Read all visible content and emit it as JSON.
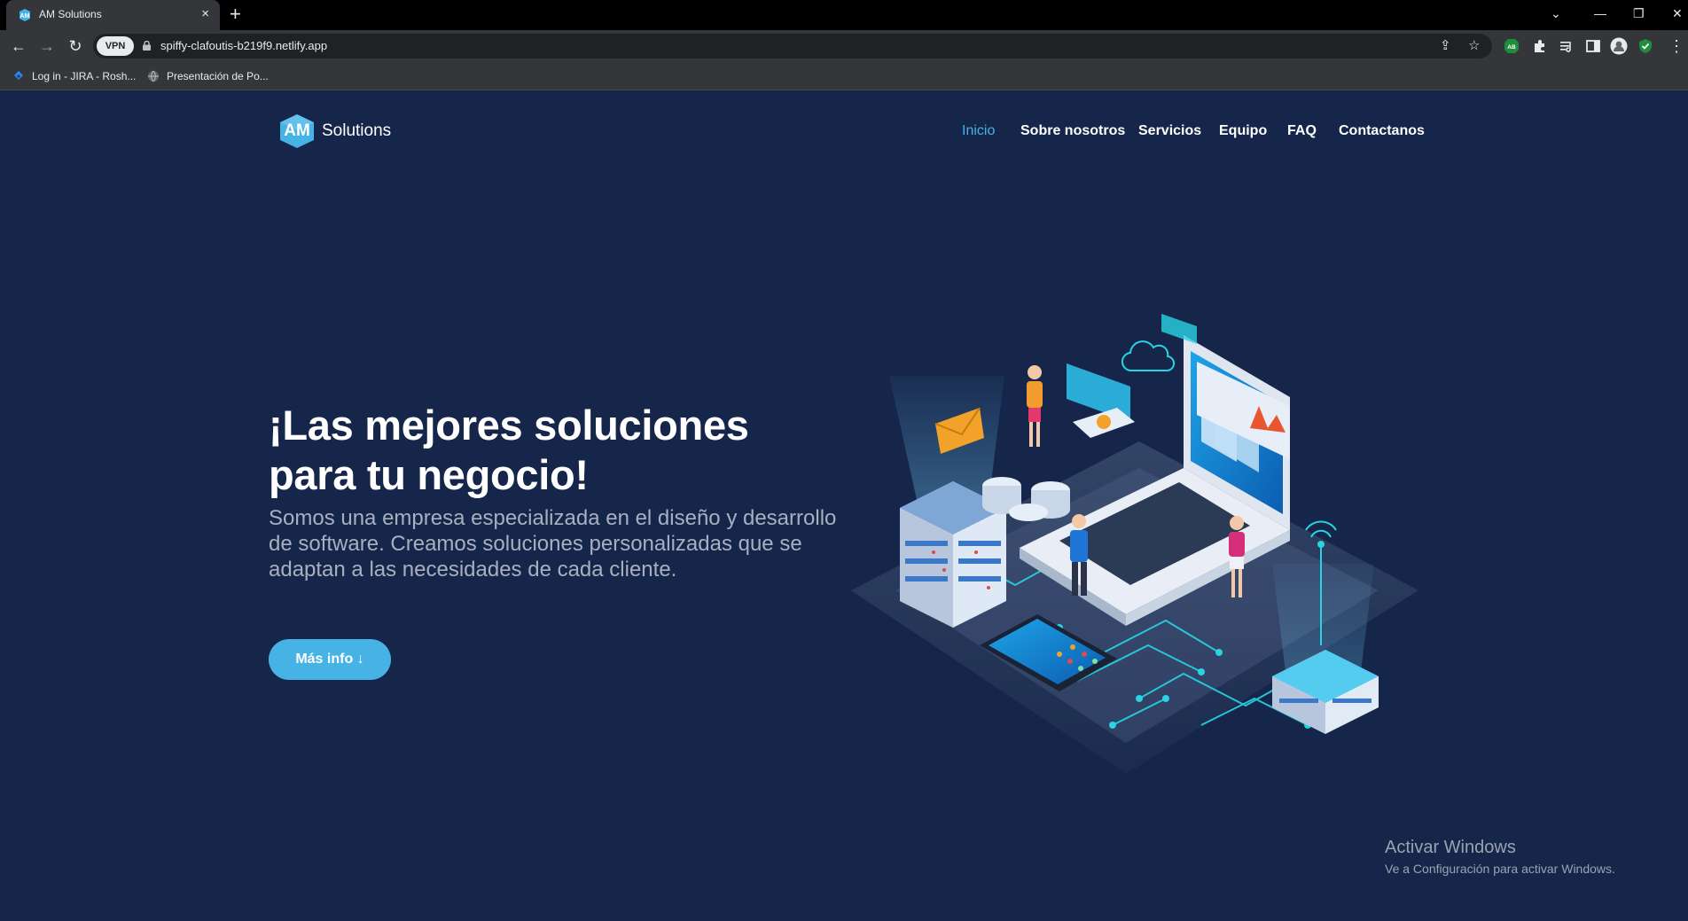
{
  "browser": {
    "tab_title": "AM Solutions",
    "tab_close": "×",
    "new_tab": "+",
    "url": "spiffy-clafoutis-b219f9.netlify.app",
    "vpn_label": "VPN",
    "bookmarks": [
      {
        "label": "Log in - JIRA - Rosh...",
        "icon": "jira-icon"
      },
      {
        "label": "Presentación de Po...",
        "icon": "globe-icon"
      }
    ],
    "extensions": [
      "share-icon",
      "bookmark-star-icon",
      "adblock-icon",
      "extensions-puzzle-icon",
      "media-control-icon",
      "sidepanel-icon",
      "profile-icon",
      "shield-check-icon",
      "menu-icon"
    ],
    "window_controls": [
      "tab-search-icon",
      "minimize-icon",
      "restore-icon",
      "close-icon"
    ]
  },
  "site": {
    "logo_badge": "AM",
    "logo_word": "Solutions",
    "brand_color": "#47b2e4",
    "background_color": "#15264a",
    "nav": [
      {
        "label": "Inicio",
        "active": true
      },
      {
        "label": "Sobre nosotros",
        "active": false
      },
      {
        "label": "Servicios",
        "active": false
      },
      {
        "label": "Equipo",
        "active": false
      },
      {
        "label": "FAQ",
        "active": false
      },
      {
        "label": "Contactanos",
        "active": false
      }
    ],
    "hero": {
      "title": "¡Las mejores soluciones para tu negocio!",
      "subtitle": "Somos una empresa especializada en el diseño y desarrollo de software. Creamos soluciones personalizadas que se adaptan a las necesidades de cada cliente.",
      "cta_label": "Más info ↓"
    }
  },
  "os_watermark": {
    "title": "Activar Windows",
    "subtitle": "Ve a Configuración para activar Windows."
  }
}
